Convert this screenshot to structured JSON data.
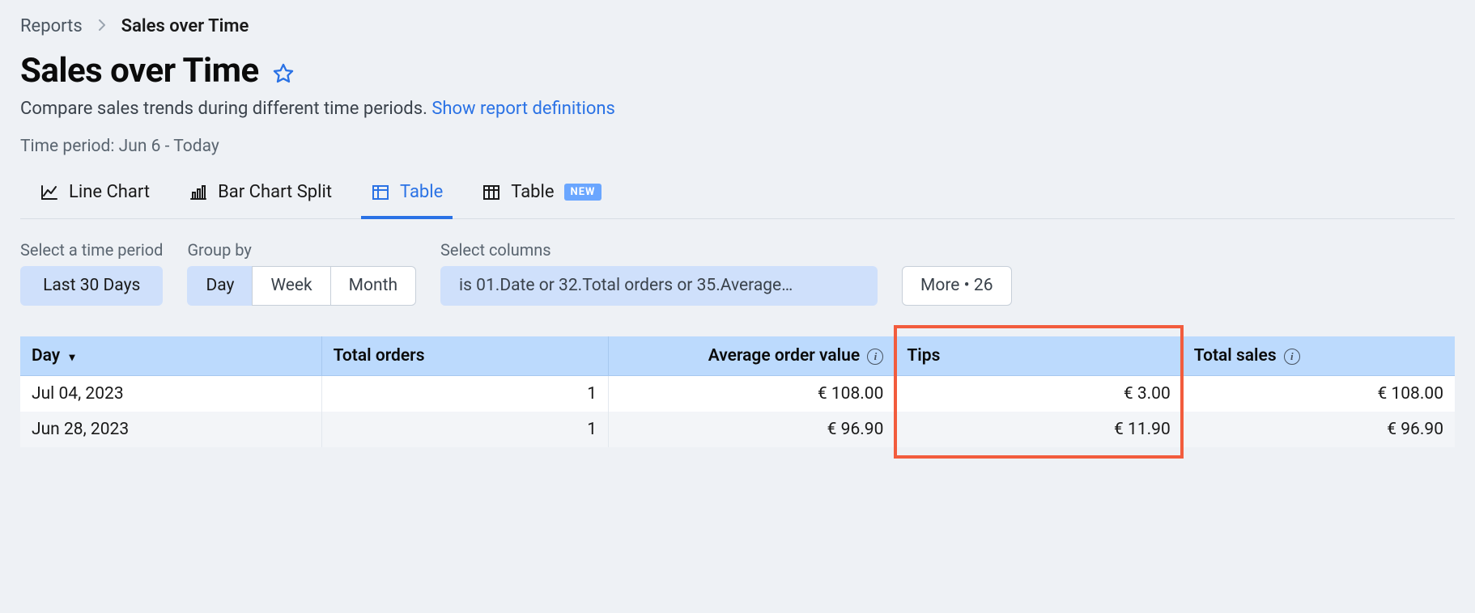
{
  "breadcrumb": {
    "root": "Reports",
    "current": "Sales over Time"
  },
  "header": {
    "title": "Sales over Time",
    "subtitle_text": "Compare sales trends during different time periods. ",
    "subtitle_link": "Show report definitions",
    "time_period_caption": "Time period: Jun 6 - Today"
  },
  "tabs": [
    {
      "label": "Line Chart",
      "active": false
    },
    {
      "label": "Bar Chart Split",
      "active": false
    },
    {
      "label": "Table",
      "active": true
    },
    {
      "label": "Table",
      "active": false,
      "badge": "NEW"
    }
  ],
  "filters": {
    "time_period": {
      "label": "Select a time period",
      "value": "Last 30 Days"
    },
    "group_by": {
      "label": "Group by",
      "options": [
        "Day",
        "Week",
        "Month"
      ],
      "selected": "Day"
    },
    "columns": {
      "label": "Select columns",
      "value": "is 01.Date or 32.Total orders or 35.Average…"
    },
    "more": {
      "label": "More • 26"
    }
  },
  "table": {
    "columns": [
      {
        "label": "Day",
        "sortable": true
      },
      {
        "label": "Total orders",
        "align": "right"
      },
      {
        "label": "Average order value",
        "align": "right",
        "info": true
      },
      {
        "label": "Tips",
        "align": "right"
      },
      {
        "label": "Total sales",
        "align": "right",
        "info": true
      }
    ],
    "rows": [
      {
        "day": "Jul 04, 2023",
        "total_orders": "1",
        "aov": "€ 108.00",
        "tips": "€ 3.00",
        "total_sales": "€ 108.00"
      },
      {
        "day": "Jun 28, 2023",
        "total_orders": "1",
        "aov": "€ 96.90",
        "tips": "€ 11.90",
        "total_sales": "€ 96.90"
      }
    ]
  }
}
